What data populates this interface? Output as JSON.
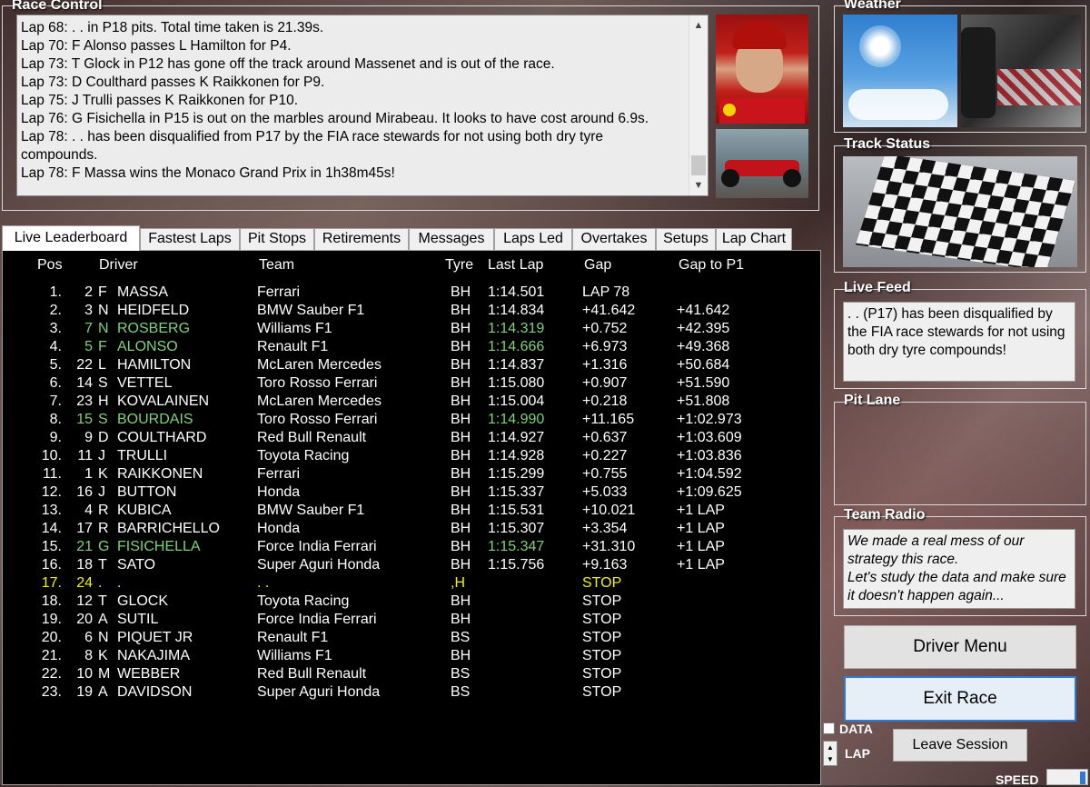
{
  "race_control": {
    "title": "Race Control",
    "log": [
      "Lap 68: . . in P18 pits. Total time taken is 21.39s.",
      "Lap 70: F Alonso passes L Hamilton for P4.",
      "Lap 73: T Glock in P12 has gone off the track around Massenet and is out of the race.",
      "Lap 73: D Coulthard passes K Raikkonen for P9.",
      "Lap 75: J Trulli passes K Raikkonen for P10.",
      "Lap 76: G Fisichella in P15 is out on the marbles around Mirabeau. It looks to have cost around 6.9s.",
      "Lap 78: . . has been disqualified from P17 by the FIA race stewards for not using both dry tyre",
      "compounds.",
      "Lap 78: F Massa wins the Monaco Grand Prix in 1h38m45s!"
    ]
  },
  "tabs": [
    "Live Leaderboard",
    "Fastest Laps",
    "Pit Stops",
    "Retirements",
    "Messages",
    "Laps Led",
    "Overtakes",
    "Setups",
    "Lap Chart"
  ],
  "columns": {
    "pos": "Pos",
    "driver": "Driver",
    "team": "Team",
    "tyre": "Tyre",
    "last": "Last Lap",
    "gap": "Gap",
    "gap1": "Gap to P1"
  },
  "rows": [
    {
      "pos": "1.",
      "num": "2",
      "init": "F",
      "name": "MASSA",
      "team": "Ferrari",
      "tyre": "BH",
      "last": "1:14.501",
      "gap": "LAP 78",
      "gap1": "",
      "hl": ""
    },
    {
      "pos": "2.",
      "num": "3",
      "init": "N",
      "name": "HEIDFELD",
      "team": "BMW Sauber F1",
      "tyre": "BH",
      "last": "1:14.834",
      "gap": "+41.642",
      "gap1": "+41.642",
      "hl": ""
    },
    {
      "pos": "3.",
      "num": "7",
      "init": "N",
      "name": "ROSBERG",
      "team": "Williams F1",
      "tyre": "BH",
      "last": "1:14.319",
      "gap": "+0.752",
      "gap1": "+42.395",
      "hl": "green"
    },
    {
      "pos": "4.",
      "num": "5",
      "init": "F",
      "name": "ALONSO",
      "team": "Renault F1",
      "tyre": "BH",
      "last": "1:14.666",
      "gap": "+6.973",
      "gap1": "+49.368",
      "hl": "green"
    },
    {
      "pos": "5.",
      "num": "22",
      "init": "L",
      "name": "HAMILTON",
      "team": "McLaren Mercedes",
      "tyre": "BH",
      "last": "1:14.837",
      "gap": "+1.316",
      "gap1": "+50.684",
      "hl": ""
    },
    {
      "pos": "6.",
      "num": "14",
      "init": "S",
      "name": "VETTEL",
      "team": "Toro Rosso Ferrari",
      "tyre": "BH",
      "last": "1:15.080",
      "gap": "+0.907",
      "gap1": "+51.590",
      "hl": ""
    },
    {
      "pos": "7.",
      "num": "23",
      "init": "H",
      "name": "KOVALAINEN",
      "team": "McLaren Mercedes",
      "tyre": "BH",
      "last": "1:15.004",
      "gap": "+0.218",
      "gap1": "+51.808",
      "hl": ""
    },
    {
      "pos": "8.",
      "num": "15",
      "init": "S",
      "name": "BOURDAIS",
      "team": "Toro Rosso Ferrari",
      "tyre": "BH",
      "last": "1:14.990",
      "gap": "+11.165",
      "gap1": "+1:02.973",
      "hl": "green"
    },
    {
      "pos": "9.",
      "num": "9",
      "init": "D",
      "name": "COULTHARD",
      "team": "Red Bull Renault",
      "tyre": "BH",
      "last": "1:14.927",
      "gap": "+0.637",
      "gap1": "+1:03.609",
      "hl": ""
    },
    {
      "pos": "10.",
      "num": "11",
      "init": "J",
      "name": "TRULLI",
      "team": "Toyota Racing",
      "tyre": "BH",
      "last": "1:14.928",
      "gap": "+0.227",
      "gap1": "+1:03.836",
      "hl": ""
    },
    {
      "pos": "11.",
      "num": "1",
      "init": "K",
      "name": "RAIKKONEN",
      "team": "Ferrari",
      "tyre": "BH",
      "last": "1:15.299",
      "gap": "+0.755",
      "gap1": "+1:04.592",
      "hl": ""
    },
    {
      "pos": "12.",
      "num": "16",
      "init": "J",
      "name": "BUTTON",
      "team": "Honda",
      "tyre": "BH",
      "last": "1:15.337",
      "gap": "+5.033",
      "gap1": "+1:09.625",
      "hl": ""
    },
    {
      "pos": "13.",
      "num": "4",
      "init": "R",
      "name": "KUBICA",
      "team": "BMW Sauber F1",
      "tyre": "BH",
      "last": "1:15.531",
      "gap": "+10.021",
      "gap1": "+1 LAP",
      "hl": ""
    },
    {
      "pos": "14.",
      "num": "17",
      "init": "R",
      "name": "BARRICHELLO",
      "team": "Honda",
      "tyre": "BH",
      "last": "1:15.307",
      "gap": "+3.354",
      "gap1": "+1 LAP",
      "hl": ""
    },
    {
      "pos": "15.",
      "num": "21",
      "init": "G",
      "name": "FISICHELLA",
      "team": "Force India Ferrari",
      "tyre": "BH",
      "last": "1:15.347",
      "gap": "+31.310",
      "gap1": "+1 LAP",
      "hl": "green"
    },
    {
      "pos": "16.",
      "num": "18",
      "init": "T",
      "name": "SATO",
      "team": "Super Aguri Honda",
      "tyre": "BH",
      "last": "1:15.756",
      "gap": "+9.163",
      "gap1": "+1 LAP",
      "hl": ""
    },
    {
      "pos": "17.",
      "num": "24",
      "init": ".",
      "name": ".",
      "team": ". .",
      "tyre": ",H",
      "last": "",
      "gap": "STOP",
      "gap1": "",
      "hl": "yellow"
    },
    {
      "pos": "18.",
      "num": "12",
      "init": "T",
      "name": "GLOCK",
      "team": "Toyota Racing",
      "tyre": "BH",
      "last": "",
      "gap": "STOP",
      "gap1": "",
      "hl": ""
    },
    {
      "pos": "19.",
      "num": "20",
      "init": "A",
      "name": "SUTIL",
      "team": "Force India Ferrari",
      "tyre": "BH",
      "last": "",
      "gap": "STOP",
      "gap1": "",
      "hl": ""
    },
    {
      "pos": "20.",
      "num": "6",
      "init": "N",
      "name": "PIQUET JR",
      "team": "Renault F1",
      "tyre": "BS",
      "last": "",
      "gap": "STOP",
      "gap1": "",
      "hl": ""
    },
    {
      "pos": "21.",
      "num": "8",
      "init": "K",
      "name": "NAKAJIMA",
      "team": "Williams F1",
      "tyre": "BH",
      "last": "",
      "gap": "STOP",
      "gap1": "",
      "hl": ""
    },
    {
      "pos": "22.",
      "num": "10",
      "init": "M",
      "name": "WEBBER",
      "team": "Red Bull Renault",
      "tyre": "BS",
      "last": "",
      "gap": "STOP",
      "gap1": "",
      "hl": ""
    },
    {
      "pos": "23.",
      "num": "19",
      "init": "A",
      "name": "DAVIDSON",
      "team": "Super Aguri Honda",
      "tyre": "BS",
      "last": "",
      "gap": "STOP",
      "gap1": "",
      "hl": ""
    }
  ],
  "weather": {
    "title": "Weather"
  },
  "track_status": {
    "title": "Track Status"
  },
  "live_feed": {
    "title": "Live Feed",
    "text": ". . (P17) has been disqualified by the FIA race stewards for not using both dry tyre compounds!"
  },
  "pit_lane": {
    "title": "Pit Lane"
  },
  "team_radio": {
    "title": "Team Radio",
    "line1": "We made a real mess of our strategy this race.",
    "line2": "Let's study the data and make sure it doesn't happen again..."
  },
  "buttons": {
    "driver_menu": "Driver Menu",
    "exit_race": "Exit Race",
    "leave_session": "Leave Session"
  },
  "controls": {
    "data_label": "DATA",
    "lap_label": "LAP",
    "speed_label": "SPEED"
  },
  "colors": {
    "highlight_green": "#7ed27a",
    "highlight_yellow": "#f2f200",
    "focus_blue": "#2f7ad6"
  }
}
